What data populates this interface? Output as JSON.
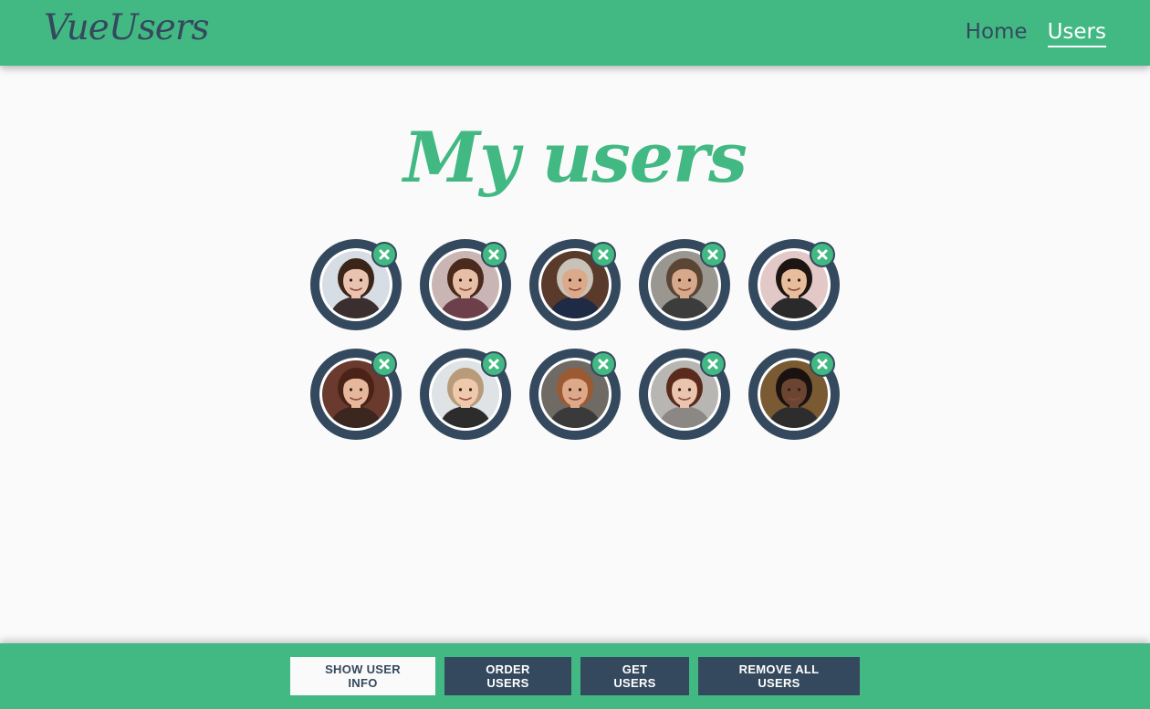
{
  "header": {
    "logo": "VueUsers",
    "nav": [
      {
        "label": "Home",
        "active": false
      },
      {
        "label": "Users",
        "active": true
      }
    ]
  },
  "main": {
    "title": "My users",
    "users": [
      {
        "skin": "#e9c3b0",
        "hair": "#3b2418",
        "bg": "#d7dde5",
        "shirt": "#3a2e2e"
      },
      {
        "skin": "#e6bfa6",
        "hair": "#4a2a1c",
        "bg": "#c9b6b4",
        "shirt": "#6d3f4a"
      },
      {
        "skin": "#dcaa8a",
        "hair": "#c8c2b8",
        "bg": "#5a3a2a",
        "shirt": "#1f2a44"
      },
      {
        "skin": "#d7a98b",
        "hair": "#5b4636",
        "bg": "#9a9791",
        "shirt": "#3c3c3c"
      },
      {
        "skin": "#e8bd9b",
        "hair": "#1d1512",
        "bg": "#e2c8c6",
        "shirt": "#2a2a2a"
      },
      {
        "skin": "#e7b79b",
        "hair": "#4a2217",
        "bg": "#6a3a2e",
        "shirt": "#3b2620"
      },
      {
        "skin": "#f0c9ac",
        "hair": "#b89b7a",
        "bg": "#dfe3e6",
        "shirt": "#2c2c2c"
      },
      {
        "skin": "#dea98a",
        "hair": "#9c5a32",
        "bg": "#6f6a64",
        "shirt": "#3a3a3a"
      },
      {
        "skin": "#ebc4ad",
        "hair": "#5a2b1d",
        "bg": "#b8b6b3",
        "shirt": "#8a8784"
      },
      {
        "skin": "#6b4532",
        "hair": "#1a1210",
        "bg": "#7a5a32",
        "shirt": "#2d2d2d"
      }
    ],
    "remove_icon": "close-icon"
  },
  "footer": {
    "buttons": {
      "show_user_info": "SHOW USER INFO",
      "order_users": "ORDER USERS",
      "get_users": "GET USERS",
      "remove_all_users": "REMOVE ALL USERS"
    }
  },
  "colors": {
    "accent": "#42b983",
    "dark": "#35495e",
    "background": "#fafafa"
  }
}
